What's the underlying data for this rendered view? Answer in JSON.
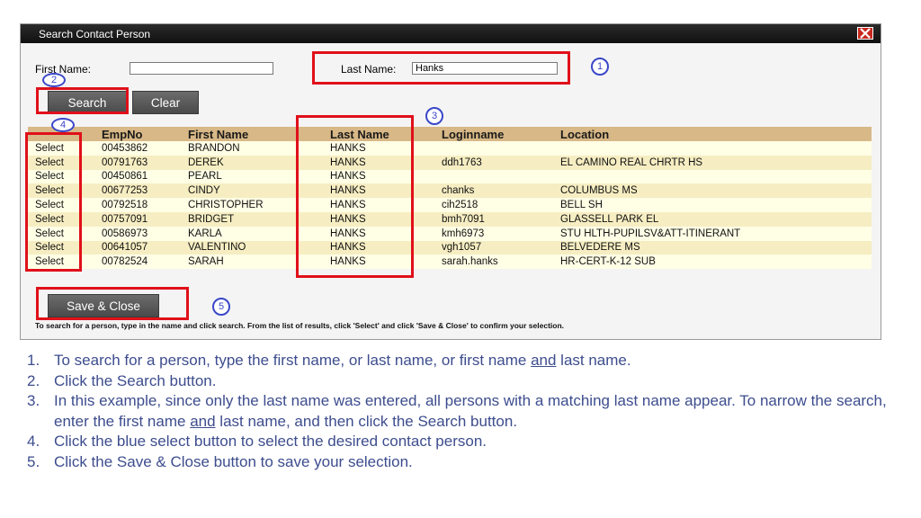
{
  "dialog": {
    "title": "Search Contact Person",
    "first_name_label": "First Name:",
    "first_name_value": "",
    "last_name_label": "Last Name:",
    "last_name_value": "Hanks",
    "search_label": "Search",
    "clear_label": "Clear",
    "save_close_label": "Save & Close",
    "footer_note": "To search for a person, type in the name and click search. From the list of results, click 'Select' and click 'Save & Close' to confirm your selection."
  },
  "callouts": [
    "1",
    "2",
    "3",
    "4",
    "5"
  ],
  "table": {
    "headers": [
      "",
      "EmpNo",
      "First Name",
      "Last Name",
      "Loginname",
      "Location"
    ],
    "rows": [
      {
        "select": "Select",
        "empno": "00453862",
        "first": "BRANDON",
        "last": "HANKS",
        "login": "",
        "location": ""
      },
      {
        "select": "Select",
        "empno": "00791763",
        "first": "DEREK",
        "last": "HANKS",
        "login": "ddh1763",
        "location": "EL CAMINO REAL CHRTR HS"
      },
      {
        "select": "Select",
        "empno": "00450861",
        "first": "PEARL",
        "last": "HANKS",
        "login": "",
        "location": ""
      },
      {
        "select": "Select",
        "empno": "00677253",
        "first": "CINDY",
        "last": "HANKS",
        "login": "chanks",
        "location": "COLUMBUS MS"
      },
      {
        "select": "Select",
        "empno": "00792518",
        "first": "CHRISTOPHER",
        "last": "HANKS",
        "login": "cih2518",
        "location": "BELL SH"
      },
      {
        "select": "Select",
        "empno": "00757091",
        "first": "BRIDGET",
        "last": "HANKS",
        "login": "bmh7091",
        "location": "GLASSELL PARK EL"
      },
      {
        "select": "Select",
        "empno": "00586973",
        "first": "KARLA",
        "last": "HANKS",
        "login": "kmh6973",
        "location": "STU HLTH-PUPILSV&ATT-ITINERANT"
      },
      {
        "select": "Select",
        "empno": "00641057",
        "first": "VALENTINO",
        "last": "HANKS",
        "login": "vgh1057",
        "location": "BELVEDERE MS"
      },
      {
        "select": "Select",
        "empno": "00782524",
        "first": "SARAH",
        "last": "HANKS",
        "login": "sarah.hanks",
        "location": "HR-CERT-K-12 SUB"
      }
    ]
  },
  "instructions": [
    {
      "num": "1.",
      "parts": [
        "To search for a person, type the first name, or last name, or first name ",
        "and",
        " last name."
      ]
    },
    {
      "num": "2.",
      "parts": [
        "Click the Search button."
      ]
    },
    {
      "num": "3.",
      "parts": [
        "In this example, since only the last name was entered, all persons with a matching last name appear. To narrow the search, enter the first name ",
        "and",
        " last name, and then click the Search button."
      ]
    },
    {
      "num": "4.",
      "parts": [
        "Click the blue select button to select the desired contact person."
      ]
    },
    {
      "num": "5.",
      "parts": [
        "Click the Save & Close button to save your selection."
      ]
    }
  ],
  "colors": {
    "highlight": "#e0101a",
    "callout": "#3a47c8",
    "instruction_text": "#3d4d8e",
    "select_link": "#1c35b4",
    "table_header": "#d8b886"
  }
}
